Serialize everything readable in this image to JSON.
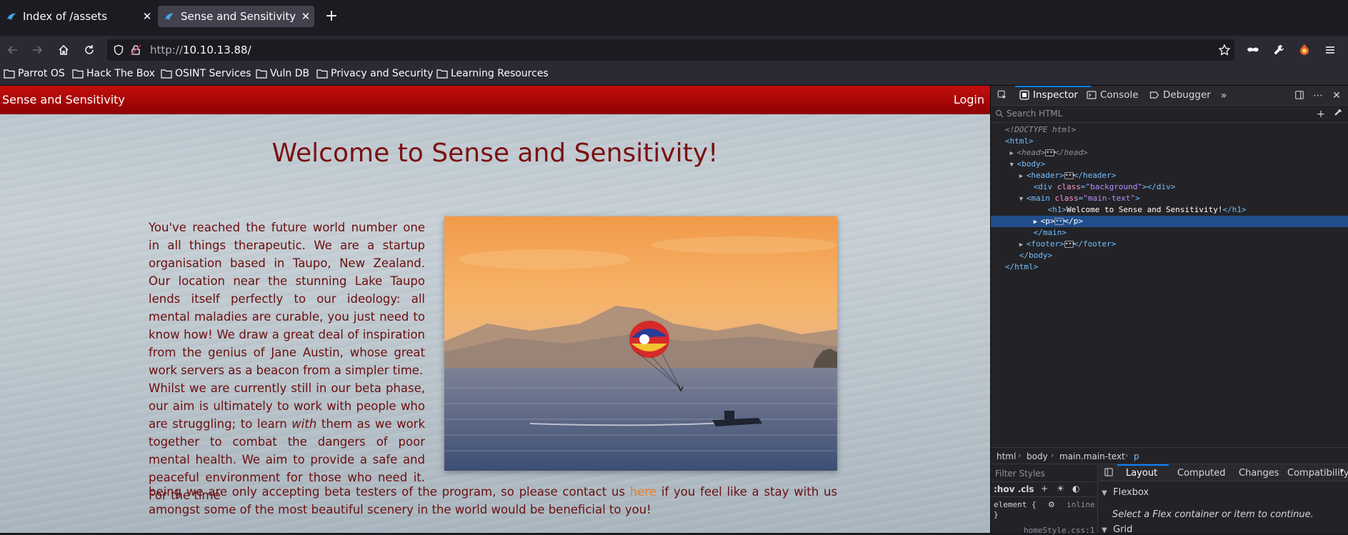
{
  "browser": {
    "tabs": [
      {
        "title": "Index of /assets",
        "active": false
      },
      {
        "title": "Sense and Sensitivity",
        "active": true
      }
    ],
    "url": {
      "protocol": "http://",
      "host": "10.10.13.88/"
    },
    "bookmarks": [
      "Parrot OS",
      "Hack The Box",
      "OSINT Services",
      "Vuln DB",
      "Privacy and Security",
      "Learning Resources"
    ]
  },
  "site": {
    "brand": "Sense and Sensitivity",
    "login": "Login",
    "heading": "Welcome to Sense and Sensitivity!",
    "para1": "You've reached the future world number one in all things therapeutic. We are a startup organisation based in Taupo, New Zealand. Our location near the stunning Lake Taupo lends itself perfectly to our ideology: all mental maladies are curable, you just need to know how! We draw a great deal of inspiration from the genius of Jane Austin, whose great work servers as a beacon from a simpler time.",
    "para2_a": "Whilst we are currently still in our beta phase, our aim is ultimately to work with people who are struggling; to learn",
    "para2_em": "with",
    "para2_b": "them as we work together to combat the dangers of poor mental health. We aim to provide a safe and peaceful environment for those who need it. For the time",
    "para3_a": "being we are only accepting beta testers of the program, so please contact us",
    "para3_link": "here",
    "para3_b": "if you feel like a stay with us amongst some of the most beautiful scenery in the world would be beneficial to you!"
  },
  "devtools": {
    "tabs": [
      "Inspector",
      "Console",
      "Debugger"
    ],
    "search_placeholder": "Search HTML",
    "tree": {
      "doctype": "<!DOCTYPE html>",
      "html_open": "<html>",
      "head": "<head>",
      "head_close": "</head>",
      "body_open": "<body>",
      "header": "<header>",
      "header_close": "</header>",
      "div_tag": "<div",
      "div_attr": "class",
      "div_val": "\"background\"",
      "div_close": "></div>",
      "main_tag": "<main",
      "main_attr": "class",
      "main_val": "\"main-text\"",
      "main_close": ">",
      "h1_open": "<h1>",
      "h1_text": "Welcome to Sense and Sensitivity!",
      "h1_close": "</h1>",
      "p_open": "<p>",
      "p_close": "</p>",
      "main_end": "</main>",
      "footer": "<footer>",
      "footer_close": "</footer>",
      "body_close": "</body>",
      "html_close": "</html>"
    },
    "breadcrumbs": [
      "html",
      "body",
      "main.main-text",
      "p"
    ],
    "filter_styles": "Filter Styles",
    "styles_toolbar": ":hov  .cls",
    "element_rule": "element {",
    "element_close": "}",
    "inline_label": "inline",
    "source_label": "homeStyle.css:1",
    "layout_tabs": [
      "Layout",
      "Computed",
      "Changes",
      "Compatibility"
    ],
    "flexbox_label": "Flexbox",
    "flex_message": "Select a Flex container or item to continue.",
    "grid_label": "Grid"
  }
}
